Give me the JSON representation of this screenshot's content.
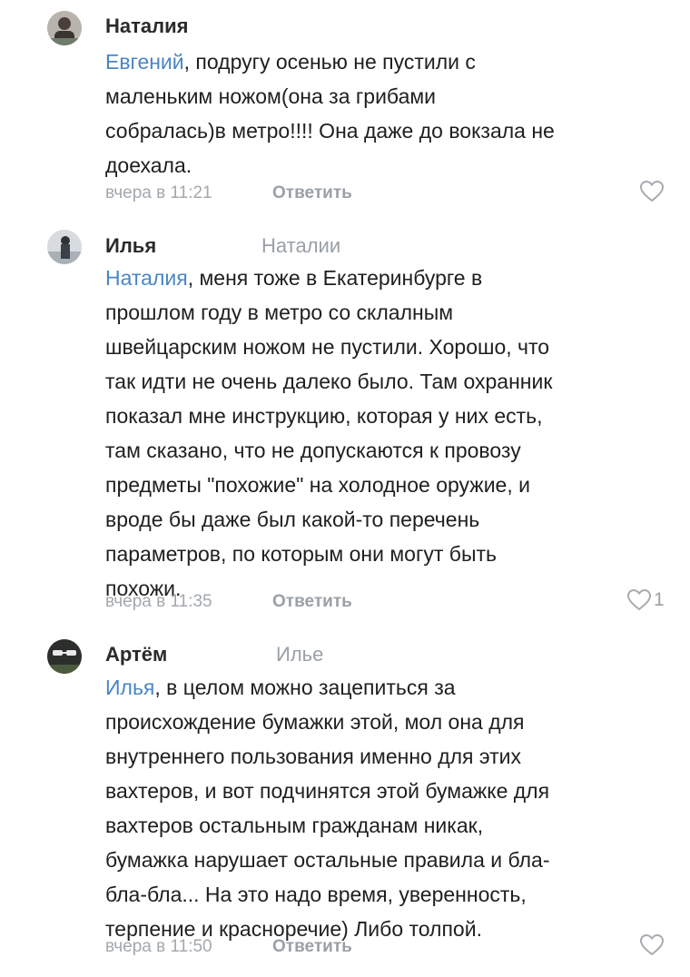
{
  "comments": [
    {
      "author": "Наталия",
      "reply_to": "",
      "mention": "Евгений",
      "text": ", подругу осенью не пустили с\nмаленьким ножом(она за грибами\nсобралась)в метро!!!! Она даже до вокзала не\nдоехала.",
      "time": "вчера в 11:21",
      "reply_label": "Ответить",
      "likes": ""
    },
    {
      "author": "Илья",
      "reply_to": "Наталии",
      "mention": "Наталия",
      "text": ", меня тоже в Екатеринбурге в\nпрошлом году в метро со склалным\nшвейцарским ножом не пустили. Хорошо, что\nтак идти не очень далеко было. Там охранник\nпоказал мне инструкцию, которая у них есть,\nтам сказано, что не допускаются к провозу\nпредметы \"похожие\" на холодное оружие, и\nвроде бы даже был какой-то перечень\nпараметров, по которым они могут быть\nпохожи.",
      "time": "вчера в 11:35",
      "reply_label": "Ответить",
      "likes": "1"
    },
    {
      "author": "Артём",
      "reply_to": "Илье",
      "mention": "Илья",
      "text": ", в целом можно зацепиться за\nпроисхождение бумажки этой, мол она для\nвнутреннего пользования именно для этих\nвахтеров, и вот подчинятся этой бумажке для\nвахтеров остальным гражданам никак,\nбумажка нарушает остальные правила и бла-\nбла-бла... На это надо время, уверенность,\nтерпение и красноречие) Либо толпой.",
      "time": "вчера в 11:50",
      "reply_label": "Ответить",
      "likes": ""
    }
  ]
}
